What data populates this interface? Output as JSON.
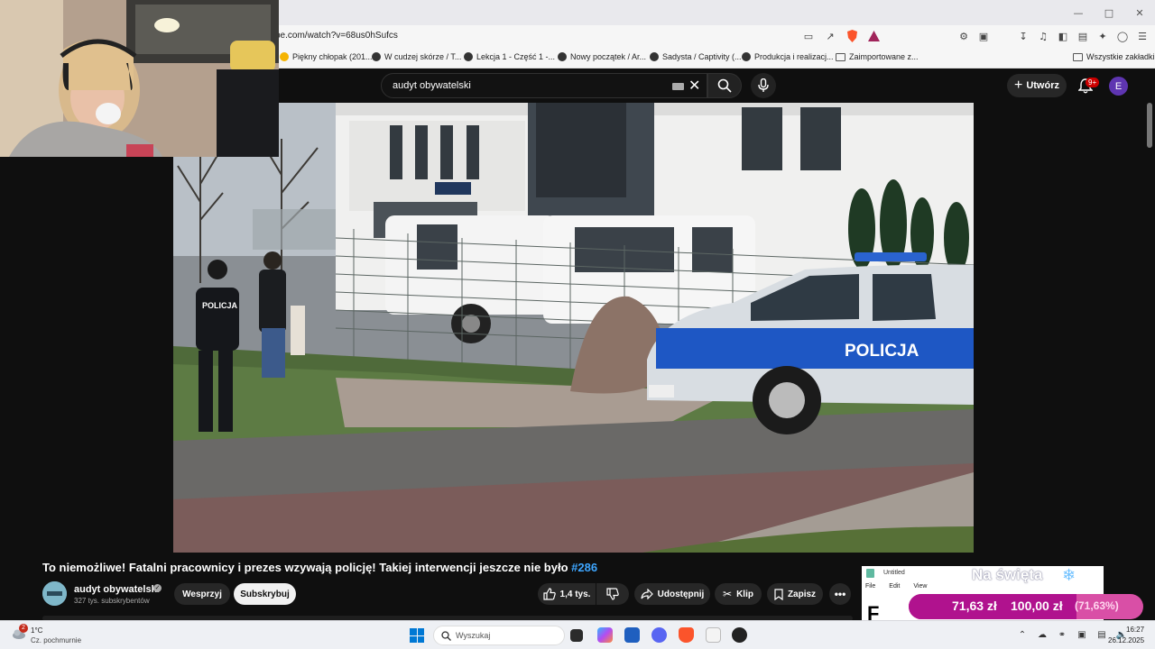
{
  "browser": {
    "url": "be.com/watch?v=68us0hSufcs",
    "bookmarks": [
      "Piękny chłopak (201...",
      "W cudzej skórze / T...",
      "Lekcja 1 - Część 1 -...",
      "Nowy początek / Ar...",
      "Sadysta / Captivity (...",
      "Produkcja i realizacj...",
      "Zaimportowane z..."
    ],
    "all_bookmarks": "Wszystkie zakładki"
  },
  "youtube": {
    "search_query": "audyt obywatelski",
    "create_label": "Utwórz",
    "notifications_badge": "9+",
    "avatar_letter": "E"
  },
  "video": {
    "overlay_text_vest": "POLICJA",
    "overlay_text_car": "POLICJA"
  },
  "meta": {
    "title": "To niemożliwe! Fatalni pracownicy i prezes wzywają policję! Takiej interwencji jeszcze nie było",
    "hashtag": "#286",
    "channel_name": "audyt obywatelski",
    "subscribers": "327 tys. subskrybentów",
    "support_label": "Wesprzyj",
    "subscribe_label": "Subskrybuj",
    "likes": "1,4 tys.",
    "share_label": "Udostępnij",
    "clip_label": "Klip",
    "save_label": "Zapisz"
  },
  "overlay": {
    "notepad_title": "Untitled",
    "notepad_menu": [
      "File",
      "Edit",
      "View"
    ],
    "notepad_partial": "F",
    "holiday_text": "Na święta",
    "goal_current": "71,63 zł",
    "goal_target": "100,00 zł",
    "goal_percent": "(71,63%)",
    "goal_fraction": 0.7163
  },
  "taskbar": {
    "weather_badge": "2",
    "temperature": "1°C",
    "weather_desc": "Cz. pochmurnie",
    "search_placeholder": "Wyszukaj",
    "time": "16:27",
    "date": "26.12.2025"
  }
}
